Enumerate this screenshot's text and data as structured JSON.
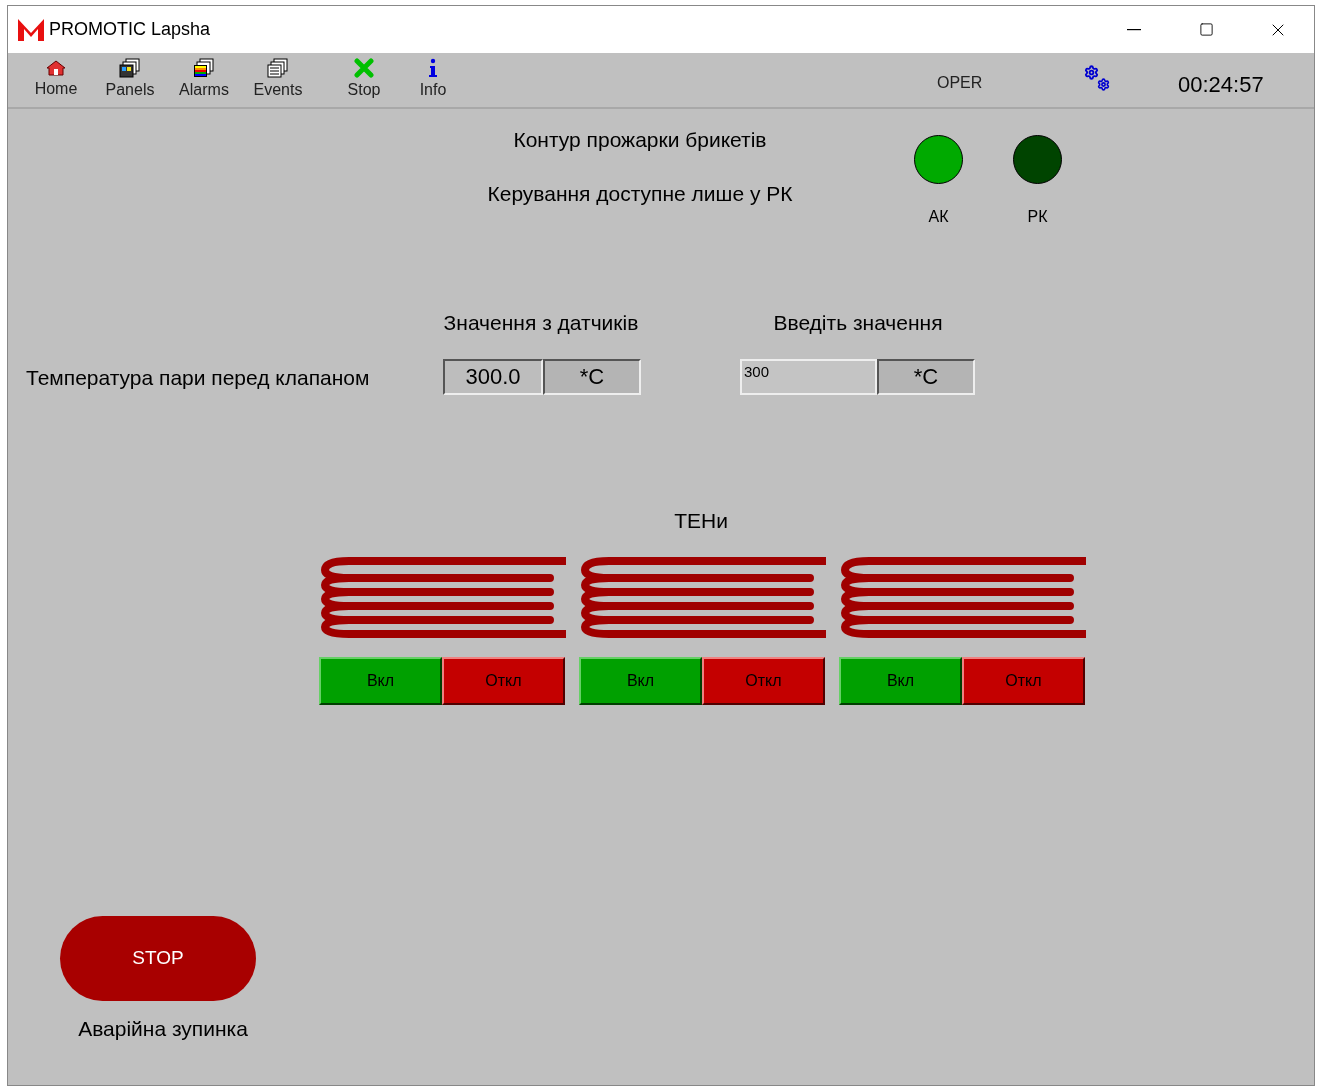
{
  "window": {
    "title": "PROMOTIC Lapsha"
  },
  "toolbar": {
    "items": [
      {
        "label": "Home",
        "kind": "home"
      },
      {
        "label": "Panels",
        "kind": "panels"
      },
      {
        "label": "Alarms",
        "kind": "alarms"
      },
      {
        "label": "Events",
        "kind": "events"
      },
      {
        "label": "Stop",
        "kind": "stop"
      },
      {
        "label": "Info",
        "kind": "info"
      }
    ],
    "mode": "OPER",
    "clock": "00:24:57"
  },
  "panel": {
    "title": "Контур прожарки брикетів",
    "subtitle": "Керування доступне лише у РК",
    "indicators": [
      {
        "label": "АК",
        "color": "#00aa00"
      },
      {
        "label": "РК",
        "color": "#004400"
      }
    ],
    "sensor_header": "Значення з датчиків",
    "input_header": "Введіть значення",
    "parameter": {
      "label": "Температура пари перед клапаном",
      "value": "300.0",
      "unit": "*C",
      "input_value": "300",
      "input_unit": "*C"
    },
    "heaters_title": "ТЕНи",
    "heaters": [
      {
        "on_label": "Вкл",
        "off_label": "Откл"
      },
      {
        "on_label": "Вкл",
        "off_label": "Откл"
      },
      {
        "on_label": "Вкл",
        "off_label": "Откл"
      }
    ],
    "emergency": {
      "button": "STOP",
      "label": "Аварійна зупинка"
    }
  }
}
